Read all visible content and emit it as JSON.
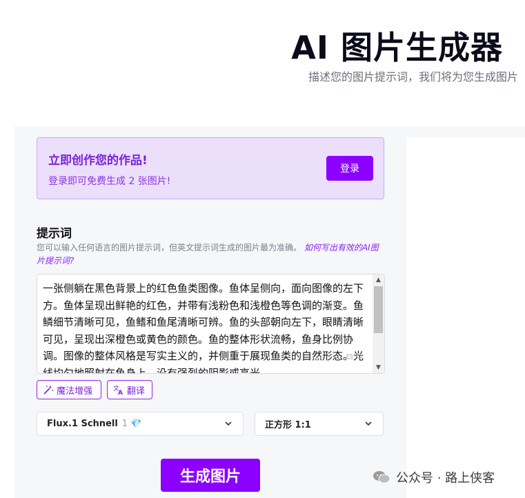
{
  "hero": {
    "title": "AI 图片生成器",
    "subtitle": "描述您的图片提示词，我们将为您生成图片"
  },
  "promo": {
    "title": "立即创作您的作品!",
    "subtitle": "登录即可免费生成 2 张图片!",
    "login_label": "登录"
  },
  "prompt": {
    "section_title": "提示词",
    "hint_text": "您可以输入任何语言的图片提示词，但英文提示词生成的图片最为准确。",
    "hint_link": "如何写出有效的AI图片提示词?",
    "value": "一张侧躺在黑色背景上的红色鱼类图像。鱼体呈侧向，面向图像的左下方。鱼体呈现出鲜艳的红色，并带有浅粉色和浅橙色等色调的渐变。鱼鳞细节清晰可见，鱼鳍和鱼尾清晰可辨。鱼的头部朝向左下，眼睛清晰可见，呈现出深橙色或黄色的颜色。鱼的整体形状流畅，鱼身比例协调。图像的整体风格是写实主义的，并侧重于展现鱼类的自然形态。光线均匀地照射在鱼身上，没有强烈的阴影或高光。"
  },
  "tools": {
    "enhance_label": "魔法增强",
    "translate_label": "翻译"
  },
  "options": {
    "model_label": "Flux.1 Schnell",
    "model_cost": "1",
    "aspect_label": "正方形 1:1"
  },
  "actions": {
    "generate_label": "生成图片"
  },
  "watermark": {
    "text": "公众号 · 路上侠客"
  },
  "colors": {
    "accent": "#8b00ff",
    "promo_bg": "#ecdffc",
    "panel_bg": "#f6f7f9"
  }
}
